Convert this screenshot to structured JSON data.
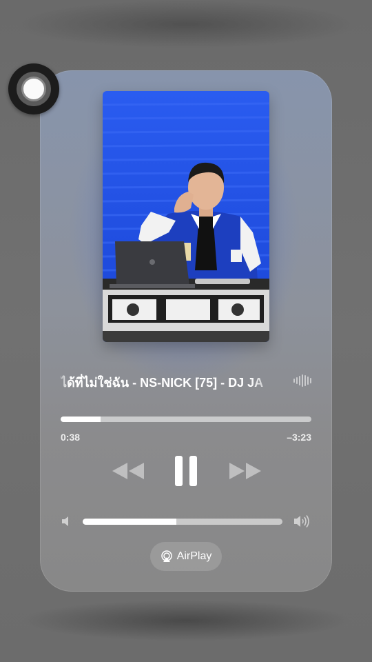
{
  "now_playing": {
    "title": "ได้ที่ไม่ใช่ฉัน - NS-NICK [75] - DJ JA",
    "elapsed": "0:38",
    "remaining": "–3:23",
    "progress_fraction": 0.16,
    "volume_fraction": 0.47
  },
  "controls": {
    "previous_icon": "rewind-icon",
    "play_pause_icon": "pause-icon",
    "next_icon": "fast-forward-icon"
  },
  "airplay": {
    "label": "AirPlay",
    "icon": "airplay-icon"
  },
  "colors": {
    "artwork_blue": "#1f4fe0",
    "card_tint": "#8794ac",
    "foreground": "#ffffff"
  }
}
